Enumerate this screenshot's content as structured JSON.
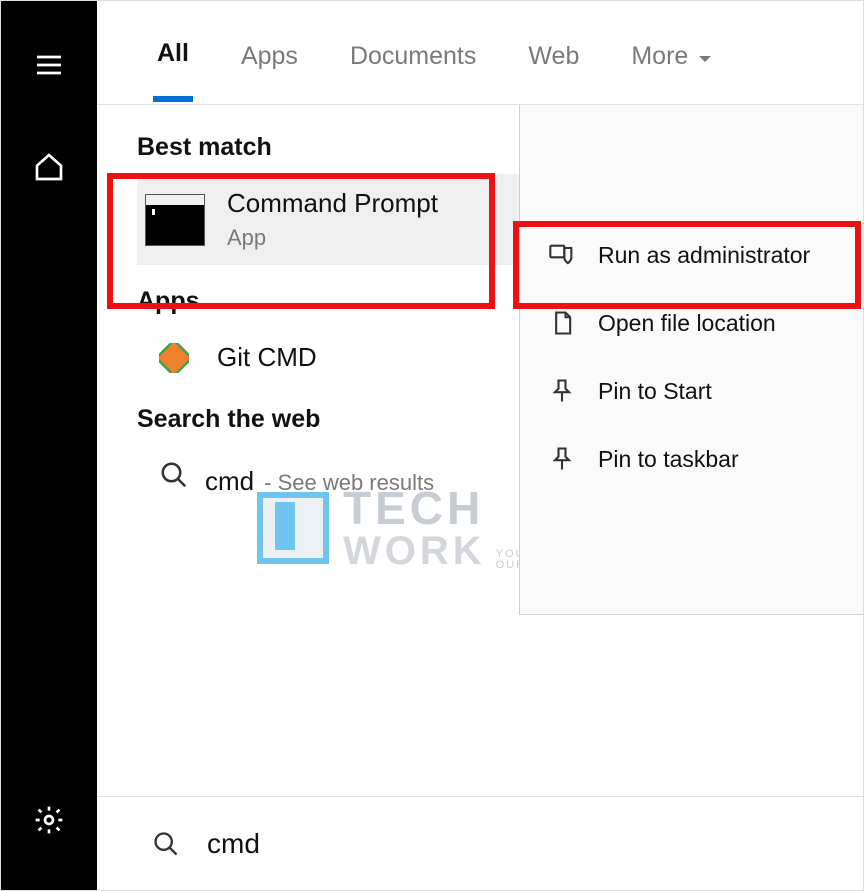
{
  "tabs": {
    "all": "All",
    "apps": "Apps",
    "documents": "Documents",
    "web": "Web",
    "more": "More"
  },
  "sections": {
    "best_match": "Best match",
    "apps": "Apps",
    "web": "Search the web"
  },
  "results": {
    "cmd": {
      "title": "Command Prompt",
      "subtitle": "App"
    },
    "git": {
      "title": "Git CMD"
    },
    "web_cmd": {
      "term": "cmd",
      "hint": "- See web results"
    }
  },
  "context": {
    "run_admin": "Run as administrator",
    "open_loc": "Open file location",
    "pin_start": "Pin to Start",
    "pin_taskbar": "Pin to taskbar"
  },
  "search": {
    "term": "cmd"
  },
  "watermark": {
    "line1": "TECH",
    "line2": "WORK",
    "tag1": "YOUR VISION",
    "tag2": "OUR FUTURE"
  }
}
